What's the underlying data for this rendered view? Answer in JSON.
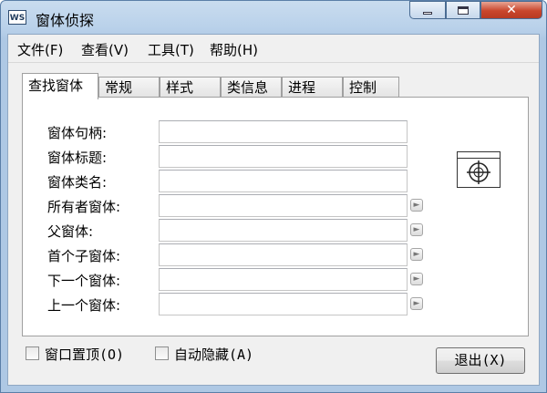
{
  "window": {
    "title": "窗体侦探",
    "icon": "ws-app-icon",
    "icon_text": "WS"
  },
  "window_controls": {
    "close_glyph": "✕"
  },
  "menu": [
    {
      "label": "文件(F)"
    },
    {
      "label": "查看(V)"
    },
    {
      "label": "工具(T)"
    },
    {
      "label": "帮助(H)"
    }
  ],
  "tabs": [
    {
      "label": "查找窗体",
      "active": true
    },
    {
      "label": "常规"
    },
    {
      "label": "样式"
    },
    {
      "label": "类信息"
    },
    {
      "label": "进程"
    },
    {
      "label": "控制"
    }
  ],
  "fields": [
    {
      "label": "窗体句柄:",
      "value": ""
    },
    {
      "label": "窗体标题:",
      "value": ""
    },
    {
      "label": "窗体类名:",
      "value": ""
    },
    {
      "label": "所有者窗体:",
      "value": "",
      "has_button": true
    },
    {
      "label": "父窗体:",
      "value": "",
      "has_button": true
    },
    {
      "label": "首个子窗体:",
      "value": "",
      "has_button": true
    },
    {
      "label": "下一个窗体:",
      "value": "",
      "has_button": true
    },
    {
      "label": "上一个窗体:",
      "value": "",
      "has_button": true
    }
  ],
  "finder_tool": {
    "icon": "crosshair-finder-icon"
  },
  "options": {
    "always_on_top": {
      "label": "窗口置顶(O)",
      "checked": false
    },
    "auto_hide": {
      "label": "自动隐藏(A)",
      "checked": false
    }
  },
  "exit_button": {
    "label": "退出(X)"
  }
}
